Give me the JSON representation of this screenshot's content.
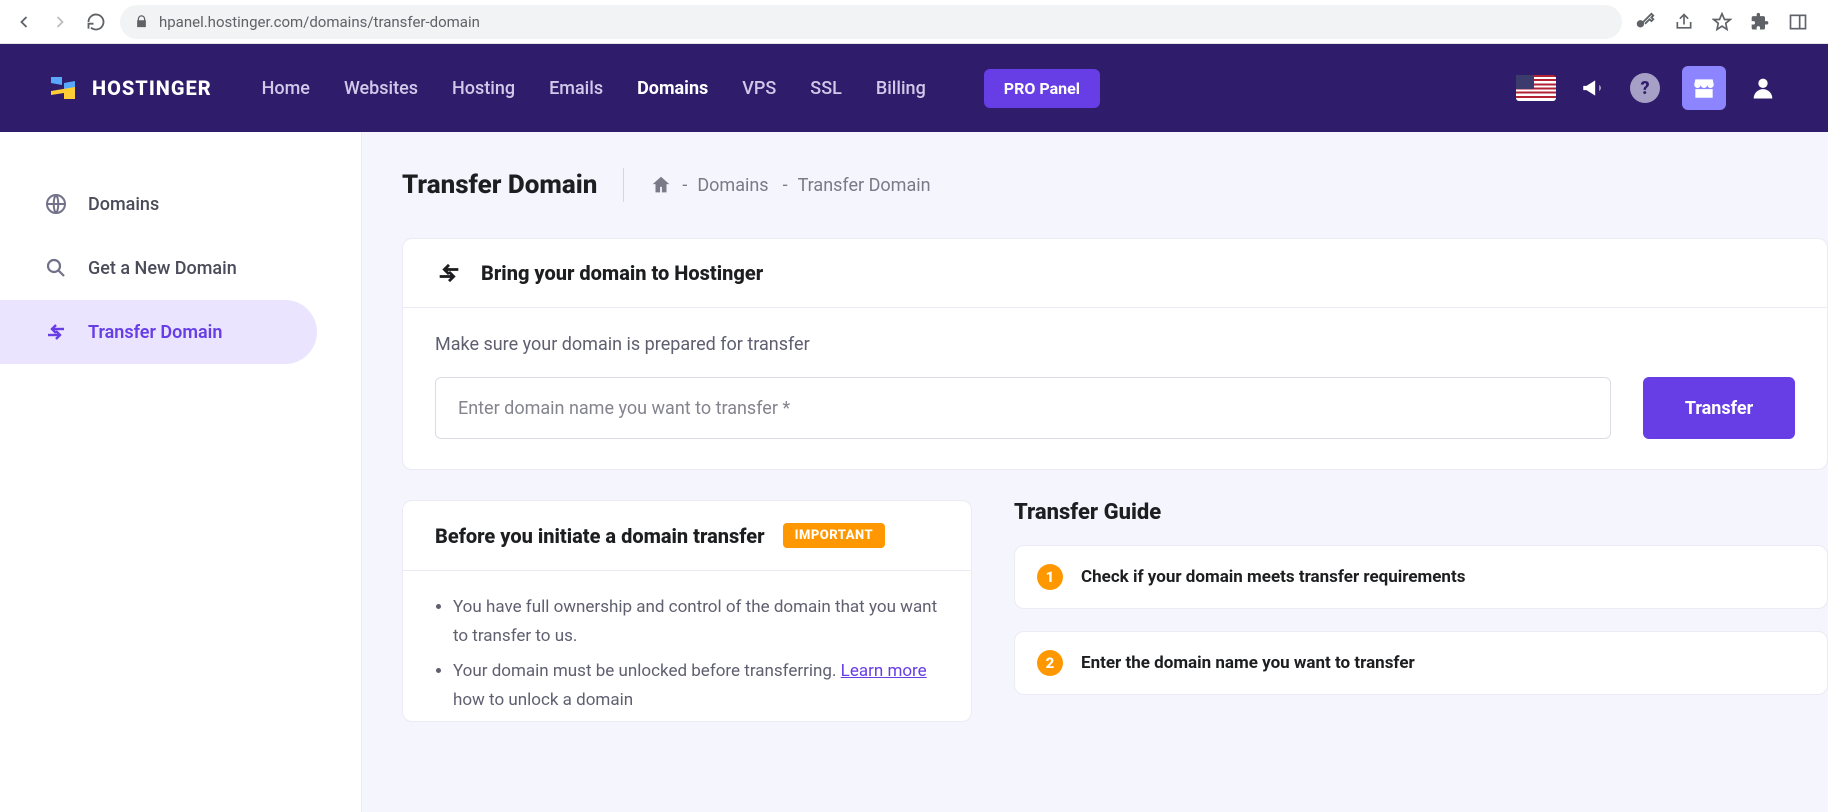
{
  "browser": {
    "url": "hpanel.hostinger.com/domains/transfer-domain"
  },
  "brand": "HOSTINGER",
  "nav": {
    "home": "Home",
    "websites": "Websites",
    "hosting": "Hosting",
    "emails": "Emails",
    "domains": "Domains",
    "vps": "VPS",
    "ssl": "SSL",
    "billing": "Billing",
    "pro": "PRO Panel"
  },
  "sidebar": {
    "domains": "Domains",
    "get_new": "Get a New Domain",
    "transfer": "Transfer Domain"
  },
  "page": {
    "title": "Transfer Domain",
    "crumb1": "Domains",
    "crumb2": "Transfer Domain",
    "sep": " - "
  },
  "card": {
    "title": "Bring your domain to Hostinger",
    "hint": "Make sure your domain is prepared for transfer",
    "placeholder": "Enter domain name you want to transfer *",
    "button": "Transfer"
  },
  "before": {
    "title": "Before you initiate a domain transfer",
    "badge": "IMPORTANT",
    "b1": "You have full ownership and control of the domain that you want to transfer to us.",
    "b2a": "Your domain must be unlocked before transferring. ",
    "b2link": "Learn more",
    "b2b": " how to unlock a domain"
  },
  "guide": {
    "title": "Transfer Guide",
    "s1": "Check if your domain meets transfer requirements",
    "s2": "Enter the domain name you want to transfer"
  }
}
